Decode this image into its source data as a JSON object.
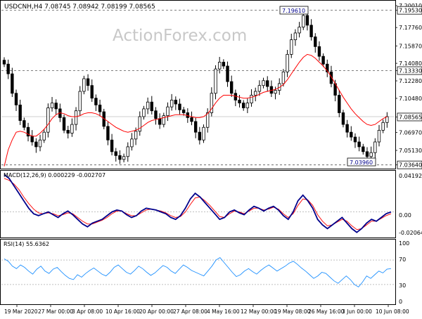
{
  "header": {
    "symbol_line": "USDCNH,H4  7.08745 7.08942 7.08199 7.08565",
    "watermark": "ActionForex.com"
  },
  "panels": {
    "price": {
      "right_labels": [
        "7.20010",
        "7.19530",
        "7.17760",
        "7.15870",
        "7.14080",
        "7.13330",
        "7.12280",
        "7.10480",
        "7.08565",
        "7.06970",
        "7.05130",
        "7.03640"
      ],
      "high_label": "7.19610",
      "low_label": "7.03960",
      "current_label": "7.08565"
    },
    "macd": {
      "title": "MACD(12,26,9) 0.000229 -0.002707",
      "right_labels": [
        "0.041923",
        "0.00",
        "-0.02064"
      ]
    },
    "rsi": {
      "title": "RSI(14) 55.6362",
      "right_labels": [
        "100",
        "70",
        "30",
        "0"
      ]
    }
  },
  "x_labels": [
    "19 Mar 2020",
    "27 Mar 00:00",
    "3 Apr 08:00",
    "10 Apr 16:00",
    "20 Apr 00:00",
    "27 Apr 08:00",
    "4 May 16:00",
    "12 May 00:00",
    "19 May 08:00",
    "26 May 16:00",
    "3 Jun 00:00",
    "10 Jun 08:00"
  ],
  "colors": {
    "candle": "#000000",
    "ma": "#ff0000",
    "macd_line": "#00008b",
    "signal_line": "#ff0000",
    "rsi_line": "#1e90ff",
    "grid": "#c0c0c0",
    "label_box": "#000000",
    "current_box_bg": "#ffffff"
  },
  "chart_data": [
    {
      "type": "candlestick",
      "title": "USDCNH,H4",
      "x_range_labels": [
        "19 Mar 2020",
        "10 Jun 08:00"
      ],
      "ylim": [
        7.034,
        7.203
      ],
      "levels": [
        7.1953,
        7.1333,
        7.0364
      ],
      "annotations": [
        {
          "text": "7.19610",
          "type": "high"
        },
        {
          "text": "7.03960",
          "type": "low"
        }
      ],
      "close_series": [
        7.14,
        7.13,
        7.11,
        7.098,
        7.082,
        7.075,
        7.066,
        7.06,
        7.055,
        7.062,
        7.07,
        7.095,
        7.1,
        7.094,
        7.085,
        7.072,
        7.069,
        7.078,
        7.092,
        7.112,
        7.125,
        7.118,
        7.105,
        7.098,
        7.091,
        7.076,
        7.062,
        7.05,
        7.046,
        7.042,
        7.045,
        7.055,
        7.063,
        7.071,
        7.086,
        7.094,
        7.101,
        7.092,
        7.084,
        7.078,
        7.087,
        7.096,
        7.103,
        7.099,
        7.093,
        7.09,
        7.085,
        7.081,
        7.07,
        7.062,
        7.075,
        7.09,
        7.11,
        7.135,
        7.142,
        7.138,
        7.122,
        7.11,
        7.103,
        7.1,
        7.095,
        7.1,
        7.108,
        7.112,
        7.118,
        7.123,
        7.117,
        7.11,
        7.113,
        7.12,
        7.132,
        7.15,
        7.165,
        7.172,
        7.178,
        7.19,
        7.18,
        7.168,
        7.158,
        7.148,
        7.14,
        7.132,
        7.12,
        7.108,
        7.09,
        7.078,
        7.07,
        7.065,
        7.06,
        7.055,
        7.05,
        7.045,
        7.049,
        7.06,
        7.072,
        7.08,
        7.086
      ],
      "ma_series": [
        7.035,
        7.052,
        7.062,
        7.07,
        7.071,
        7.07,
        7.068,
        7.066,
        7.066,
        7.069,
        7.073,
        7.078,
        7.084,
        7.088,
        7.09,
        7.089,
        7.087,
        7.086,
        7.086,
        7.087,
        7.089,
        7.09,
        7.09,
        7.089,
        7.087,
        7.084,
        7.081,
        7.078,
        7.075,
        7.073,
        7.071,
        7.07,
        7.071,
        7.072,
        7.074,
        7.077,
        7.08,
        7.082,
        7.083,
        7.084,
        7.085,
        7.086,
        7.087,
        7.088,
        7.088,
        7.088,
        7.087,
        7.086,
        7.085,
        7.085,
        7.086,
        7.089,
        7.094,
        7.1,
        7.105,
        7.108,
        7.108,
        7.108,
        7.107,
        7.106,
        7.105,
        7.105,
        7.106,
        7.107,
        7.109,
        7.111,
        7.112,
        7.113,
        7.114,
        7.116,
        7.119,
        7.124,
        7.13,
        7.136,
        7.142,
        7.147,
        7.15,
        7.149,
        7.146,
        7.142,
        7.138,
        7.133,
        7.127,
        7.12,
        7.113,
        7.106,
        7.1,
        7.094,
        7.089,
        7.085,
        7.081,
        7.078,
        7.077,
        7.078,
        7.081,
        7.084,
        7.086
      ]
    },
    {
      "type": "line",
      "title": "MACD(12,26,9)",
      "ylim": [
        -0.026,
        0.042
      ],
      "series": [
        {
          "name": "MACD",
          "values": [
            0.04,
            0.036,
            0.028,
            0.02,
            0.012,
            0.004,
            -0.002,
            -0.004,
            -0.002,
            0.0,
            -0.003,
            -0.006,
            -0.002,
            0.001,
            -0.003,
            -0.008,
            -0.013,
            -0.016,
            -0.012,
            -0.01,
            -0.008,
            -0.004,
            0.0,
            0.002,
            0.001,
            -0.003,
            -0.006,
            -0.004,
            0.001,
            0.004,
            0.003,
            0.002,
            0.0,
            -0.002,
            -0.006,
            -0.008,
            -0.004,
            0.004,
            0.014,
            0.02,
            0.016,
            0.01,
            0.004,
            -0.002,
            -0.008,
            -0.006,
            0.0,
            0.002,
            -0.001,
            -0.003,
            0.002,
            0.006,
            0.004,
            0.001,
            0.004,
            0.006,
            0.002,
            -0.004,
            -0.008,
            0.0,
            0.012,
            0.018,
            0.012,
            0.004,
            -0.008,
            -0.014,
            -0.018,
            -0.014,
            -0.01,
            -0.006,
            -0.012,
            -0.018,
            -0.022,
            -0.018,
            -0.012,
            -0.008,
            -0.01,
            -0.006,
            -0.002,
            0.0
          ]
        },
        {
          "name": "Signal",
          "values": [
            0.036,
            0.034,
            0.03,
            0.024,
            0.016,
            0.009,
            0.003,
            -0.001,
            -0.002,
            -0.001,
            -0.002,
            -0.004,
            -0.003,
            -0.001,
            -0.002,
            -0.006,
            -0.01,
            -0.013,
            -0.013,
            -0.011,
            -0.009,
            -0.006,
            -0.002,
            0.001,
            0.001,
            -0.002,
            -0.004,
            -0.004,
            -0.001,
            0.002,
            0.003,
            0.002,
            0.001,
            -0.001,
            -0.004,
            -0.006,
            -0.005,
            0.0,
            0.008,
            0.015,
            0.016,
            0.012,
            0.007,
            0.001,
            -0.005,
            -0.006,
            -0.002,
            0.001,
            0.0,
            -0.002,
            0.001,
            0.004,
            0.004,
            0.002,
            0.003,
            0.005,
            0.003,
            -0.002,
            -0.006,
            -0.002,
            0.007,
            0.014,
            0.013,
            0.007,
            -0.003,
            -0.01,
            -0.015,
            -0.014,
            -0.011,
            -0.008,
            -0.01,
            -0.015,
            -0.019,
            -0.018,
            -0.014,
            -0.01,
            -0.01,
            -0.007,
            -0.004,
            -0.002
          ]
        }
      ]
    },
    {
      "type": "line",
      "title": "RSI(14)",
      "ylim": [
        0,
        100
      ],
      "levels": [
        70,
        30
      ],
      "series": [
        {
          "name": "RSI(14)",
          "values": [
            72,
            68,
            60,
            56,
            62,
            58,
            52,
            47,
            55,
            60,
            52,
            48,
            55,
            58,
            51,
            45,
            40,
            38,
            46,
            42,
            48,
            53,
            57,
            52,
            47,
            44,
            50,
            58,
            62,
            56,
            50,
            47,
            53,
            60,
            56,
            50,
            45,
            49,
            55,
            61,
            58,
            52,
            48,
            55,
            62,
            58,
            53,
            50,
            47,
            44,
            52,
            60,
            70,
            74,
            66,
            58,
            50,
            43,
            46,
            52,
            56,
            51,
            47,
            53,
            58,
            62,
            57,
            52,
            56,
            60,
            65,
            68,
            63,
            57,
            52,
            46,
            40,
            44,
            50,
            48,
            42,
            36,
            32,
            38,
            44,
            38,
            30,
            26,
            34,
            44,
            40,
            46,
            52,
            49,
            55,
            56
          ]
        }
      ]
    }
  ]
}
